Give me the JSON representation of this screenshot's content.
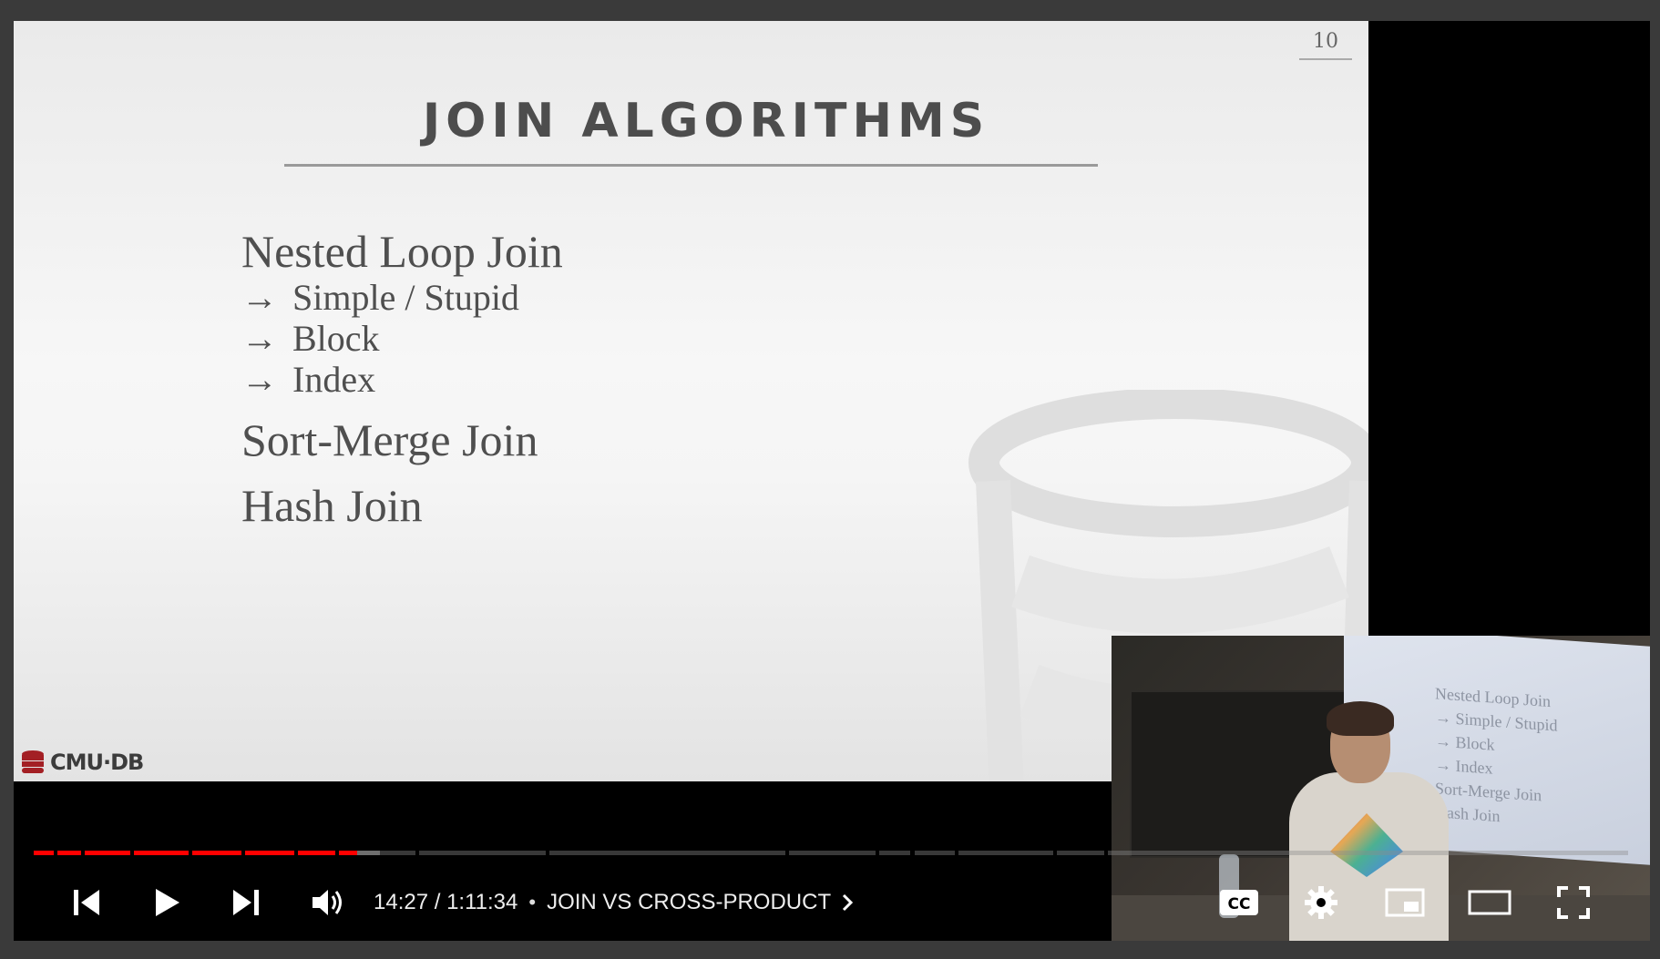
{
  "slide": {
    "number": "10",
    "title": "JOIN ALGORITHMS",
    "bullets": [
      {
        "level": 1,
        "text": "Nested Loop Join"
      },
      {
        "level": 2,
        "arrow": "→",
        "text": "Simple / Stupid"
      },
      {
        "level": 2,
        "arrow": "→",
        "text": "Block"
      },
      {
        "level": 2,
        "arrow": "→",
        "text": "Index"
      },
      {
        "level": 1,
        "text": "Sort-Merge Join"
      },
      {
        "level": 1,
        "text": "Hash Join"
      }
    ],
    "logo_text": "CMU·DB"
  },
  "pip": {
    "screen_lines": [
      "Nested Loop Join",
      "→ Simple / Stupid",
      "→ Block",
      "→ Index",
      "Sort-Merge Join",
      "Hash Join"
    ]
  },
  "player": {
    "progress": {
      "played_fraction": 0.203,
      "buffered_fraction": 0.217
    },
    "current_time": "14:27",
    "duration": "1:11:34",
    "time_separator": "/",
    "chapter_title": "JOIN VS CROSS-PRODUCT",
    "icons": {
      "previous": "skip-previous-icon",
      "play": "play-icon",
      "next": "skip-next-icon",
      "volume": "volume-icon",
      "chapter": "chevron-right-icon",
      "captions": "cc-icon",
      "settings": "gear-icon",
      "miniplayer": "miniplayer-icon",
      "theater": "theater-mode-icon",
      "fullscreen": "fullscreen-icon"
    },
    "colors": {
      "played": "#ff0000",
      "controls": "#ffffff"
    }
  }
}
